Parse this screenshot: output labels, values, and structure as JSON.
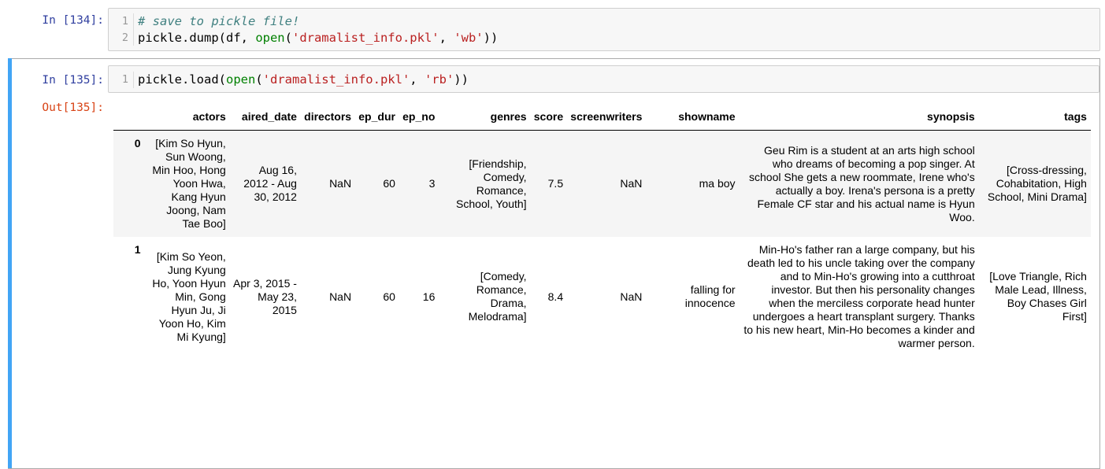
{
  "cells": [
    {
      "prompt": "In [134]:",
      "lines": [
        {
          "num": "1",
          "tokens": [
            {
              "t": "# save to pickle file!",
              "c": "cm-comment"
            }
          ]
        },
        {
          "num": "2",
          "tokens": [
            {
              "t": "pickle.dump(df, ",
              "c": ""
            },
            {
              "t": "open",
              "c": "cm-builtin"
            },
            {
              "t": "(",
              "c": ""
            },
            {
              "t": "'dramalist_info.pkl'",
              "c": "cm-string"
            },
            {
              "t": ", ",
              "c": ""
            },
            {
              "t": "'wb'",
              "c": "cm-string"
            },
            {
              "t": "))",
              "c": ""
            }
          ]
        }
      ]
    },
    {
      "prompt": "In [135]:",
      "out_prompt": "Out[135]:",
      "lines": [
        {
          "num": "1",
          "tokens": [
            {
              "t": "pickle.load(",
              "c": ""
            },
            {
              "t": "open",
              "c": "cm-builtin"
            },
            {
              "t": "(",
              "c": ""
            },
            {
              "t": "'dramalist_info.pkl'",
              "c": "cm-string"
            },
            {
              "t": ", ",
              "c": ""
            },
            {
              "t": "'rb'",
              "c": "cm-string"
            },
            {
              "t": "))",
              "c": ""
            }
          ]
        }
      ]
    }
  ],
  "dataframe": {
    "columns": [
      "actors",
      "aired_date",
      "directors",
      "ep_dur",
      "ep_no",
      "genres",
      "score",
      "screenwriters",
      "showname",
      "synopsis",
      "tags"
    ],
    "rows": [
      {
        "index": "0",
        "cells": [
          "[Kim So Hyun, Sun Woong, Min Hoo, Hong Yoon Hwa, Kang Hyun Joong, Nam Tae Boo]",
          "Aug 16, 2012 - Aug 30, 2012",
          "NaN",
          "60",
          "3",
          "[Friendship, Comedy, Romance, School, Youth]",
          "7.5",
          "NaN",
          "ma boy",
          "Geu Rim is a student at an arts high school who dreams of becoming a pop singer. At school She gets a new roommate, Irene who's actually a boy. Irena's persona is a pretty Female CF star and his actual name is Hyun Woo.",
          "[Cross-dressing, Cohabitation, High School, Mini Drama]"
        ]
      },
      {
        "index": "1",
        "cells": [
          "[Kim So Yeon, Jung Kyung Ho, Yoon Hyun Min, Gong Hyun Ju, Ji Yoon Ho, Kim Mi Kyung]",
          "Apr 3, 2015 - May 23, 2015",
          "NaN",
          "60",
          "16",
          "[Comedy, Romance, Drama, Melodrama]",
          "8.4",
          "NaN",
          "falling for innocence",
          "Min-Ho's father ran a large company, but his death led to his uncle taking over the company and to Min-Ho's growing into a cutthroat investor. But then his personality changes when the merciless corporate head hunter undergoes a heart transplant surgery. Thanks to his new heart, Min-Ho becomes a kinder and warmer person.",
          "[Love Triangle, Rich Male Lead, Illness, Boy Chases Girl First]"
        ]
      }
    ]
  }
}
